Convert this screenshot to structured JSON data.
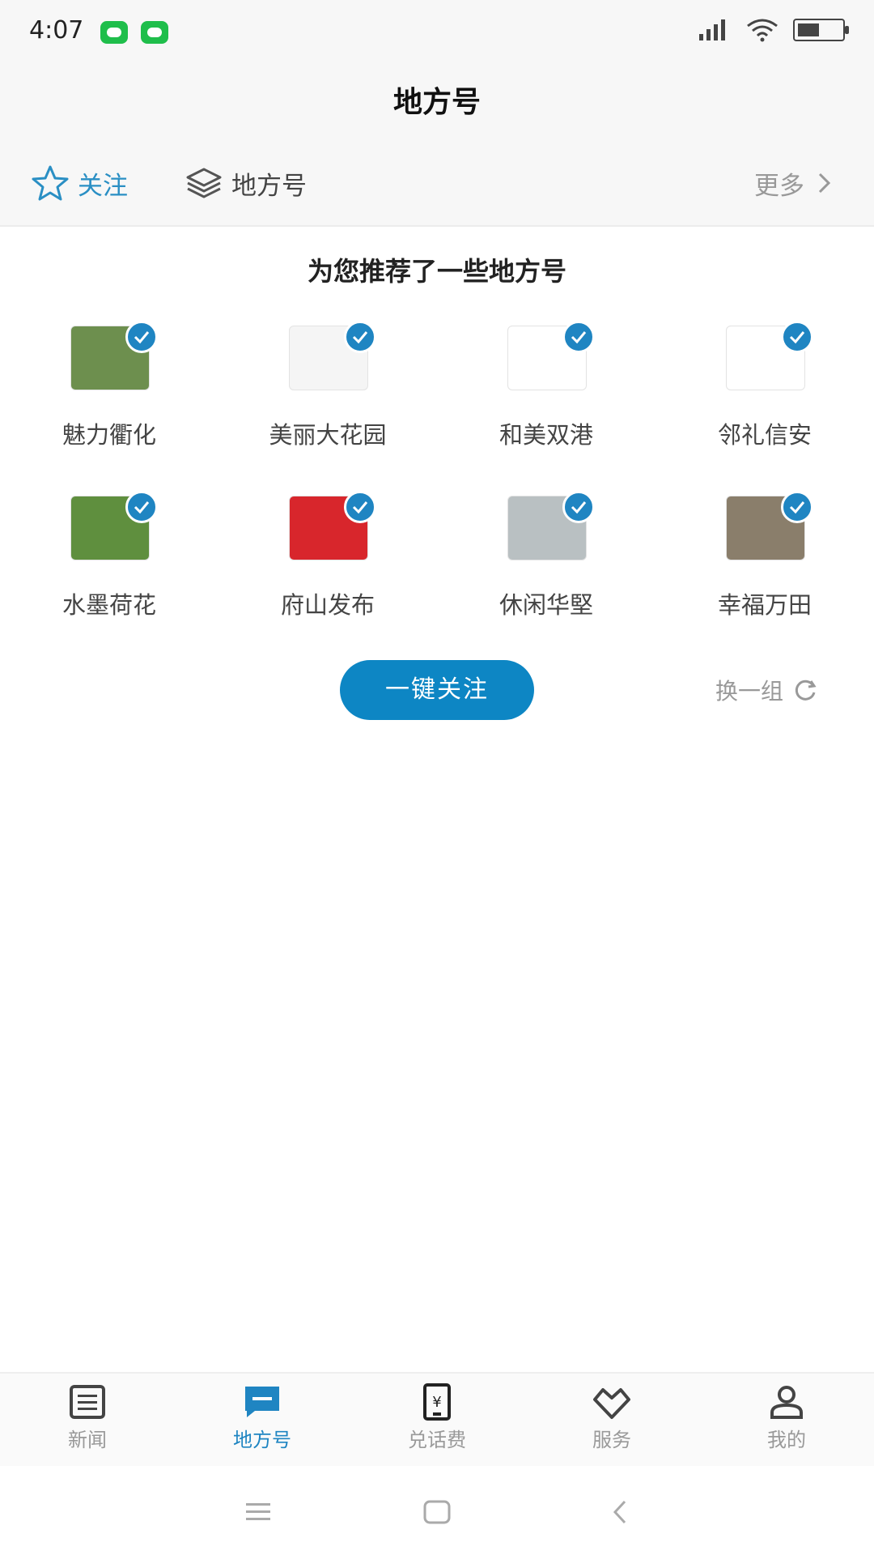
{
  "status": {
    "time": "4:07",
    "battery_level": 0.5
  },
  "header": {
    "title": "地方号"
  },
  "tabs": {
    "follow": "关注",
    "local": "地方号",
    "more": "更多"
  },
  "recommend": {
    "title": "为您推荐了一些地方号",
    "items": [
      {
        "name": "魅力衢化",
        "color": "#6d8f4e"
      },
      {
        "name": "美丽大花园",
        "color": "#f5f5f5"
      },
      {
        "name": "和美双港",
        "color": "#ffffff"
      },
      {
        "name": "邻礼信安",
        "color": "#ffffff"
      },
      {
        "name": "水墨荷花",
        "color": "#5f8f3e"
      },
      {
        "name": "府山发布",
        "color": "#d8262c"
      },
      {
        "name": "休闲华堅",
        "color": "#b9c0c2"
      },
      {
        "name": "幸福万田",
        "color": "#8a7e6b"
      }
    ],
    "follow_all": "一键关注",
    "refresh": "换一组"
  },
  "bottom_nav": [
    {
      "label": "新闻",
      "icon": "news-icon",
      "active": false
    },
    {
      "label": "地方号",
      "icon": "chat-icon",
      "active": true
    },
    {
      "label": "兑话费",
      "icon": "phone-pay-icon",
      "active": false
    },
    {
      "label": "服务",
      "icon": "service-icon",
      "active": false
    },
    {
      "label": "我的",
      "icon": "profile-icon",
      "active": false
    }
  ],
  "colors": {
    "accent": "#1f85c2",
    "button": "#0d86c4"
  }
}
